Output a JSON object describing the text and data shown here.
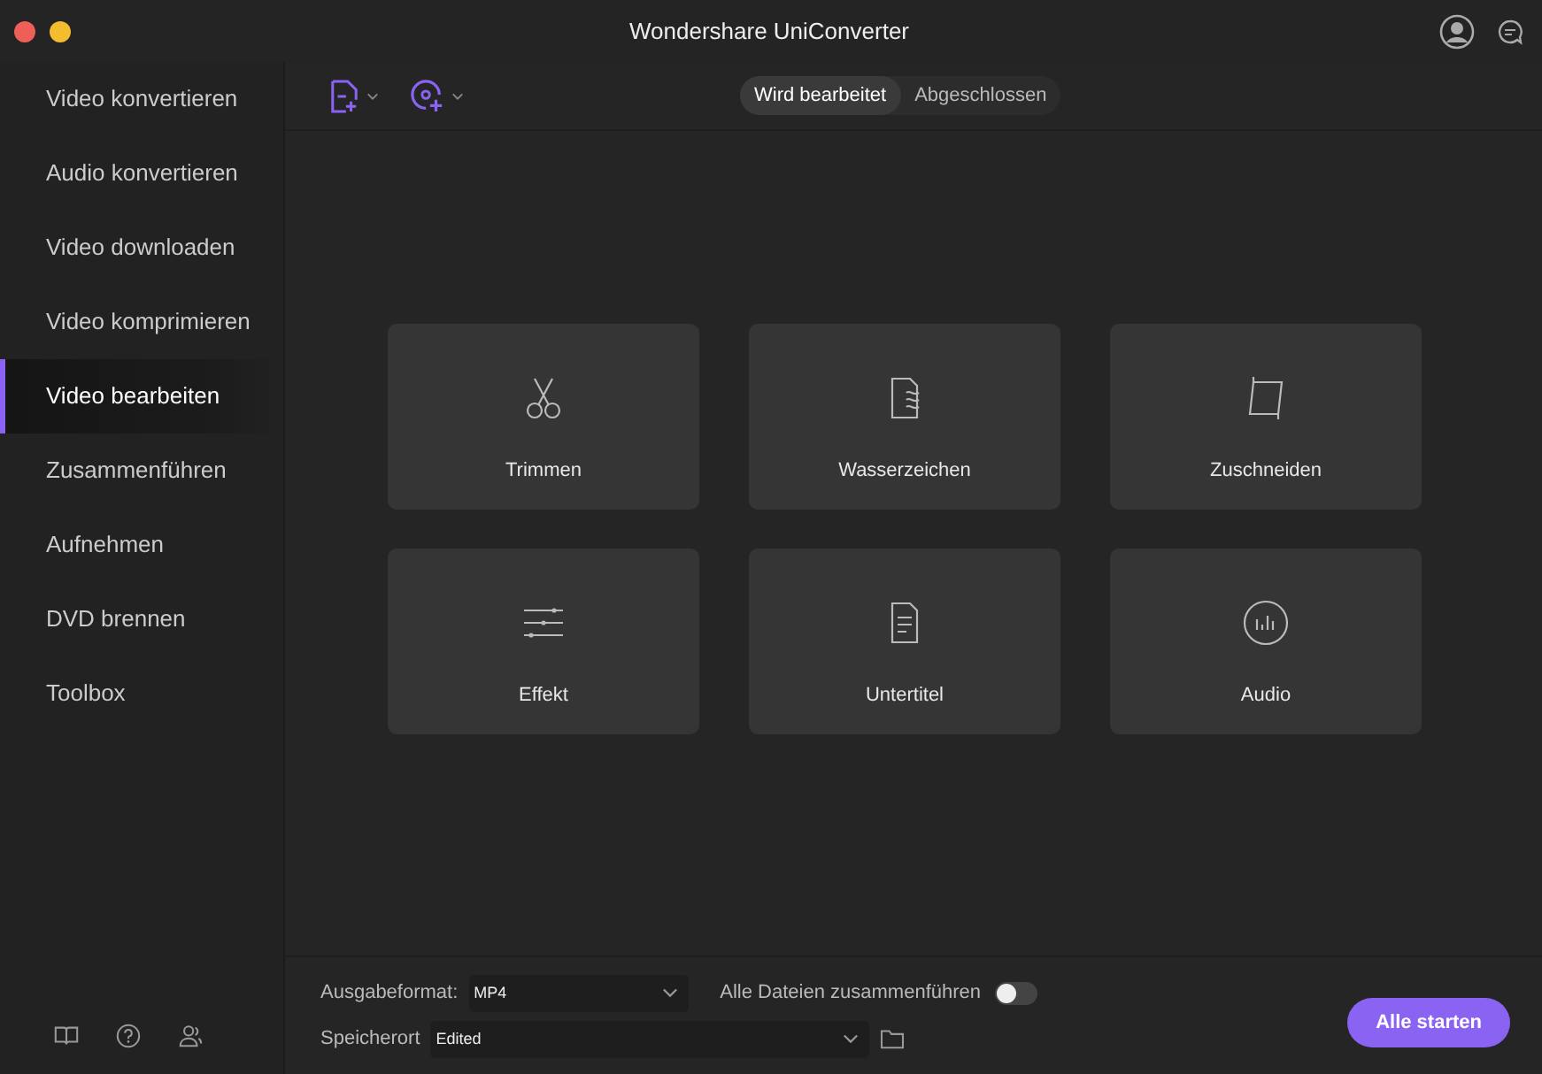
{
  "window": {
    "title": "Wondershare UniConverter"
  },
  "sidebar": {
    "items": [
      {
        "label": "Video konvertieren",
        "selected": false
      },
      {
        "label": "Audio konvertieren",
        "selected": false
      },
      {
        "label": "Video downloaden",
        "selected": false
      },
      {
        "label": "Video komprimieren",
        "selected": false
      },
      {
        "label": "Video bearbeiten",
        "selected": true
      },
      {
        "label": "Zusammenführen",
        "selected": false
      },
      {
        "label": "Aufnehmen",
        "selected": false
      },
      {
        "label": "DVD brennen",
        "selected": false
      },
      {
        "label": "Toolbox",
        "selected": false
      }
    ]
  },
  "tabs": [
    {
      "label": "Wird bearbeitet",
      "selected": true
    },
    {
      "label": "Abgeschlossen",
      "selected": false
    }
  ],
  "tools": [
    {
      "label": "Trimmen",
      "kind": "scissors"
    },
    {
      "label": "Wasserzeichen",
      "kind": "watermark"
    },
    {
      "label": "Zuschneiden",
      "kind": "crop"
    },
    {
      "label": "Effekt",
      "kind": "sliders"
    },
    {
      "label": "Untertitel",
      "kind": "document"
    },
    {
      "label": "Audio",
      "kind": "audio"
    }
  ],
  "bottom": {
    "format_label": "Ausgabeformat:",
    "format_value": "MP4",
    "merge_label": "Alle Dateien zusammenführen",
    "merge_on": false,
    "location_label": "Speicherort",
    "location_value": "Edited",
    "start_button": "Alle starten"
  }
}
